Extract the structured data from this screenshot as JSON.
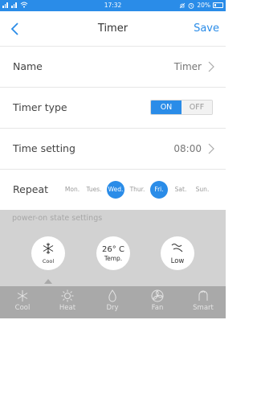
{
  "status_bar": {
    "time": "17:32",
    "battery": "20%",
    "network": "HD"
  },
  "header": {
    "title": "Timer",
    "save_label": "Save"
  },
  "rows": {
    "name": {
      "label": "Name",
      "value": "Timer"
    },
    "timer_type": {
      "label": "Timer type",
      "on_label": "ON",
      "off_label": "OFF",
      "state": "ON"
    },
    "time_setting": {
      "label": "Time setting",
      "value": "08:00"
    },
    "repeat": {
      "label": "Repeat",
      "days": [
        {
          "label": "Mon.",
          "selected": false
        },
        {
          "label": "Tues.",
          "selected": false
        },
        {
          "label": "Wed.",
          "selected": true
        },
        {
          "label": "Thur.",
          "selected": false
        },
        {
          "label": "Fri.",
          "selected": true
        },
        {
          "label": "Sat.",
          "selected": false
        },
        {
          "label": "Sun.",
          "selected": false
        }
      ]
    }
  },
  "power_on": {
    "title": "power-on state settings",
    "mode": "Cool",
    "temperature": "26° C",
    "temperature_label": "Temp.",
    "fan": "Low"
  },
  "modes": [
    {
      "label": "Cool",
      "icon": "snowflake-icon"
    },
    {
      "label": "Heat",
      "icon": "sun-icon"
    },
    {
      "label": "Dry",
      "icon": "droplet-icon"
    },
    {
      "label": "Fan",
      "icon": "fan-icon"
    },
    {
      "label": "Smart",
      "icon": "smart-icon"
    }
  ],
  "colors": {
    "accent": "#2a8ce8",
    "panel": "#d2d2d2",
    "mode_bar": "#a9a9a9"
  }
}
